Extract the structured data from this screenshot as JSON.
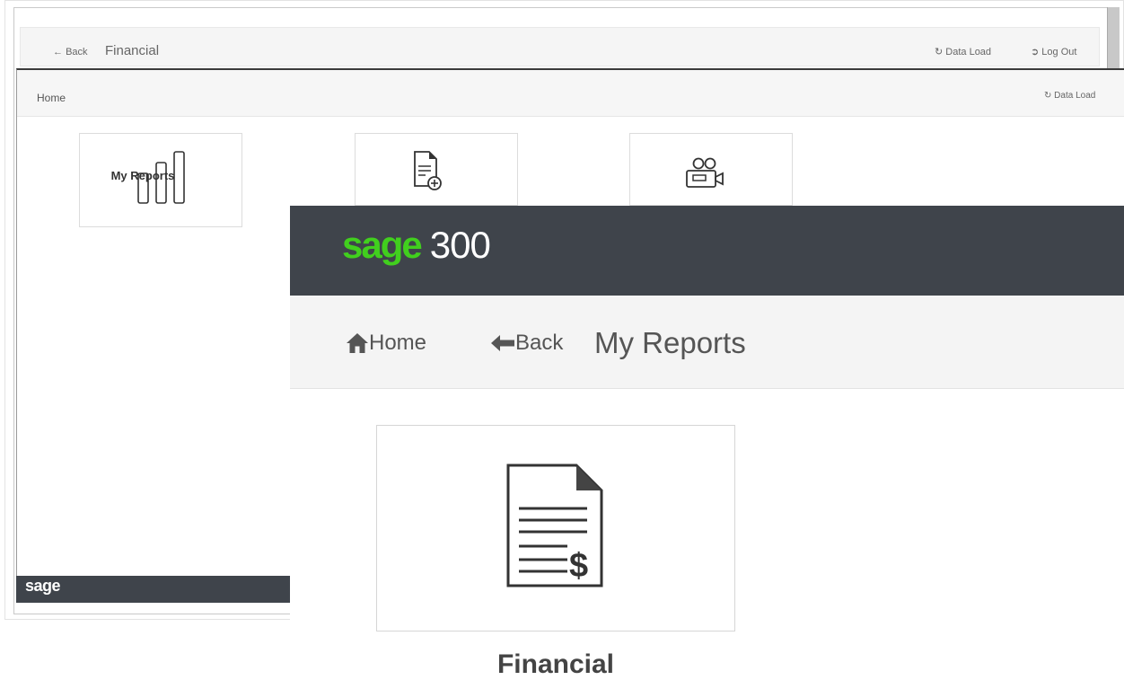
{
  "background_window": {
    "topbar": {
      "back_label": "Back",
      "title": "Financial",
      "data_load_label": "Data Load",
      "log_out_label": "Log Out"
    },
    "homebar": {
      "home_label": "Home",
      "data_load_label": "Data Load"
    },
    "tiles": [
      {
        "label": "My Reports",
        "icon": "bar-chart-icon"
      },
      {
        "label": "",
        "icon": "add-document-icon"
      },
      {
        "label": "",
        "icon": "video-camera-icon"
      }
    ],
    "footer": {
      "logo_text": "sage"
    }
  },
  "foreground_window": {
    "header": {
      "brand": "sage",
      "product_number": "300"
    },
    "nav": {
      "home_label": "Home",
      "back_label": "Back",
      "title": "My Reports"
    },
    "tiles": [
      {
        "label": "Financial",
        "icon": "financial-report-icon"
      }
    ]
  },
  "colors": {
    "header_bg": "#3f444b",
    "brand_green": "#41cf1e",
    "nav_bg": "#f4f4f4"
  }
}
